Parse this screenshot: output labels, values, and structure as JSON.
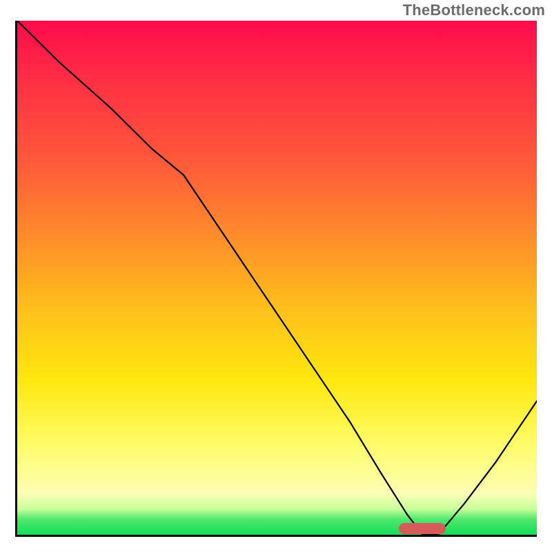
{
  "watermark": "TheBottleneck.com",
  "chart_data": {
    "type": "line",
    "title": "",
    "xlabel": "",
    "ylabel": "",
    "xlim": [
      0,
      100
    ],
    "ylim": [
      0,
      100
    ],
    "series": [
      {
        "name": "bottleneck-curve",
        "x": [
          0,
          8,
          18,
          26,
          32,
          40,
          48,
          56,
          64,
          70,
          75,
          78,
          81,
          86,
          92,
          100
        ],
        "y": [
          100,
          92,
          83,
          75,
          70,
          58,
          46,
          34,
          22,
          12,
          4,
          0,
          0,
          6,
          14,
          26
        ]
      }
    ],
    "marker": {
      "name": "optimal-range-pill",
      "x_center_pct": 78,
      "y_center_pct": 1.2,
      "width_pct": 9,
      "height_pct": 2.1,
      "color": "#d65a5a"
    },
    "background_gradient": {
      "orientation": "vertical",
      "stops": [
        {
          "pct": 0,
          "color": "#ff0b4a"
        },
        {
          "pct": 28,
          "color": "#ff5b39"
        },
        {
          "pct": 56,
          "color": "#ffbf1c"
        },
        {
          "pct": 82,
          "color": "#fffb66"
        },
        {
          "pct": 97,
          "color": "#4ee86e"
        },
        {
          "pct": 100,
          "color": "#13dd55"
        }
      ]
    }
  }
}
